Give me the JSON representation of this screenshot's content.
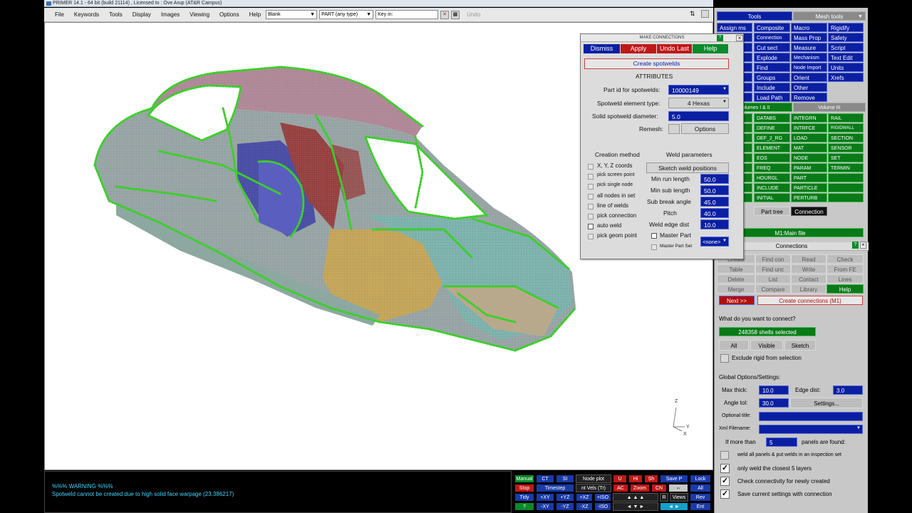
{
  "window": {
    "title": "PRIMER 14.1 - 64 bit (build 21114) , Licensed to : Ove Arup (AT&R Campus)"
  },
  "menubar": {
    "items": [
      "File",
      "Keywords",
      "Tools",
      "Display",
      "Images",
      "Viewing",
      "Options",
      "Help"
    ],
    "blank_combo": "Blank",
    "part_combo": "PART  (any type)",
    "keyin_combo": "Key in:",
    "undo": "Undo"
  },
  "triad": {
    "z": "Z",
    "y": "Y",
    "x": "X"
  },
  "messages": {
    "warning": "%%% WARNING %%%",
    "detail": "Spotweld cannot be created due to high solid face warpage (23.386217)"
  },
  "dialog": {
    "title": "MAKE CONNECTIONS",
    "buttons": {
      "dismiss": "Dismiss",
      "apply": "Apply",
      "undo_last": "Undo Last",
      "help": "Help"
    },
    "create_spotwelds": "Create spotwelds",
    "attributes_heading": "ATTRIBUTES",
    "part_id_label": "Part id for spotwelds:",
    "part_id_value": "10000149",
    "element_type_label": "Spotweld element type:",
    "element_type_value": "4 Hexas",
    "solid_diameter_label": "Solid spotweld diameter:",
    "solid_diameter_value": "5.0",
    "remesh_label": "Remesh:",
    "options_button": "Options",
    "creation_method_heading": "Creation method",
    "weld_params_heading": "Weld parameters",
    "methods": [
      "X, Y, Z coords",
      "pick screen point",
      "pick single node",
      "all nodes in set",
      "line of welds",
      "pick connection",
      "auto weld",
      "pick geom point"
    ],
    "sketch_positions": "Sketch weld positions",
    "params": [
      {
        "label": "Min run length",
        "value": "50.0"
      },
      {
        "label": "Min sub length",
        "value": "50.0"
      },
      {
        "label": "Sub break angle",
        "value": "45.0"
      },
      {
        "label": "Pitch",
        "value": "40.0"
      },
      {
        "label": "Weld edge dist",
        "value": "10.0"
      }
    ],
    "master_part": "Master Part",
    "master_part_set": "Master Part Set",
    "master_none": "<none>"
  },
  "tools_panel": {
    "tab_tools": "Tools",
    "tab_mesh": "Mesh tools",
    "col1": [
      "Assign ms",
      "ld",
      "n",
      "",
      "",
      "ord",
      "e"
    ],
    "col2": [
      "Composite",
      "Connection",
      "Cut sect",
      "Explode",
      "Find",
      "Groups",
      "Include",
      "Load Path"
    ],
    "col3": [
      "Macro",
      "Mass Prop",
      "Measure",
      "Mechanism",
      "Node Import",
      "Orient",
      "Other",
      "Remove"
    ],
    "col4": [
      "Rigidify",
      "Safety",
      "Script",
      "Text Edit",
      "Units",
      "Xrefs"
    ],
    "vol_tab1": "Volumes I & II",
    "vol_tab2": "Volume III",
    "kw_col2": [
      "DATABS",
      "DEFINE",
      "DEF_2_RG",
      "ELEMENT",
      "EOS",
      "FREQ",
      "HOURGL",
      "INCLUDE",
      "INITIAL"
    ],
    "kw_col3": [
      "INTEGRN",
      "INTRFCE",
      "LOAD",
      "MAT",
      "NODE",
      "PARAM",
      "PART",
      "PARTICLE",
      "PERTURB"
    ],
    "kw_col4": [
      "RAIL",
      "RIGIDWALL",
      "SECTION",
      "SENSOR",
      "SET",
      "TERMIN"
    ],
    "part_tree": "Part tree",
    "connection_tab": "Connection",
    "main_file": "M1:Main file"
  },
  "connections_panel": {
    "title": "Connections",
    "grid": [
      [
        "Create",
        "Find con",
        "Read",
        "Check"
      ],
      [
        "Table",
        "Find unc",
        "Write",
        "From FE"
      ],
      [
        "Delete",
        "List",
        "Contact",
        "Lines"
      ],
      [
        "Merge",
        "Compare",
        "Library",
        "Help"
      ]
    ],
    "next": "Next >>",
    "create_connections": "Create connections (M1)",
    "question": "What do you want to connect?",
    "selected": "248358 shells selected",
    "all": "All",
    "visible": "Visible",
    "sketch": "Sketch",
    "exclude_rigid": "Exclude rigid from selection",
    "global_heading": "Global Options/Settings:",
    "max_thick_label": "Max thick:",
    "max_thick_value": "10.0",
    "edge_dist_label": "Edge dist:",
    "edge_dist_value": "3.0",
    "angle_tol_label": "Angle tol:",
    "angle_tol_value": "30.0",
    "settings": "Settings...",
    "optional_title": "Optional title:",
    "xml_filename": "Xml Filename:",
    "if_more_than": "If more than",
    "panels_value": "5",
    "panels_found": "panels are found:",
    "weld_all": "weld all panels & put welds in an inspection set",
    "only_closest": "only weld the closest 5 layers",
    "check_connectivity": "Check connectivity for newly created",
    "save_settings": "Save current settings with connection"
  },
  "bottom_buttons": {
    "manual": "Manual",
    "ct": "CT",
    "si": "SI",
    "node_plot": "Node plot",
    "u": "U",
    "hi": "Hi",
    "sh": "Sh",
    "save_p": "Save P",
    "lock": "Lock",
    "stop": "Stop",
    "timestep": "Timestep",
    "nt_vels": "nt Vels (Tr)",
    "ac": "AC",
    "zoom": "Zoom",
    "cn": "CN",
    "all": "All",
    "tidy": "Tidy",
    "pxy": "+XY",
    "pyz": "+YZ",
    "pxz": "+XZ",
    "piso": "+ISO",
    "views": "Views",
    "rev": "Rev",
    "q": "?",
    "mxy": "-XY",
    "myz": "-YZ",
    "mxz": "-XZ",
    "miso": "-ISO",
    "ent": "Ent"
  },
  "colors": {
    "button_blue": "#0b1fa3",
    "button_green": "#0a7a18",
    "button_red": "#c01818",
    "weld_green": "#3ccf2a"
  }
}
